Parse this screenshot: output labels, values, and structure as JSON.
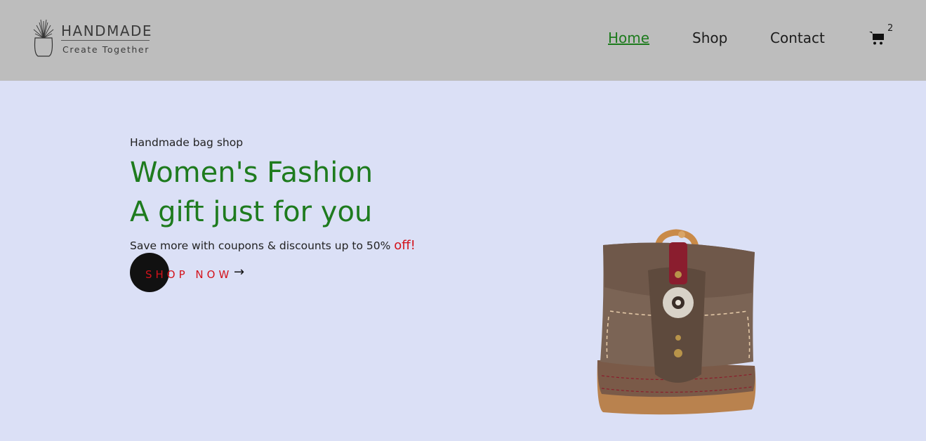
{
  "header": {
    "logo": {
      "title": "HANDMADE",
      "subtitle": "Create Together"
    },
    "nav": [
      {
        "label": "Home",
        "active": true
      },
      {
        "label": "Shop",
        "active": false
      },
      {
        "label": "Contact",
        "active": false
      }
    ],
    "cart": {
      "icon": "cart-icon",
      "count": "2"
    }
  },
  "hero": {
    "kicker": "Handmade bag shop",
    "title_line1": "Women's Fashion",
    "title_line2": "A gift just for you",
    "text": "Save more with coupons & discounts up to 50% ",
    "text_highlight": "off!",
    "cta_label": "SHOP NOW",
    "cta_icon": "arrow-right-icon",
    "image": "leather-bag-image"
  },
  "colors": {
    "header_bg": "#bdbdbd",
    "hero_bg": "#dbe0f6",
    "accent_green": "#1e7b1e",
    "accent_red": "#d3121b"
  }
}
